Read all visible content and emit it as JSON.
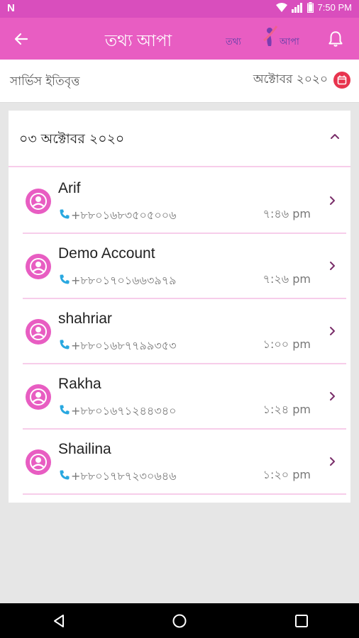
{
  "status_bar": {
    "time": "7:50 PM"
  },
  "app_bar": {
    "title": "তথ্য আপা",
    "logo_text_left": "তথ্য",
    "logo_text_right": "আপা"
  },
  "history_bar": {
    "label": "সার্ভিস ইতিবৃত্ত",
    "month": "অক্টোবর ২০২০"
  },
  "card": {
    "date": "০৩ অক্টোবর ২০২০",
    "items": [
      {
        "name": "Arif",
        "phone": "+৮৮০১৬৮৩৫০৫০০৬",
        "time": "৭:৪৬ pm"
      },
      {
        "name": "Demo Account",
        "phone": "+৮৮০১৭০১৬৬৩৯৭৯",
        "time": "৭:২৬ pm"
      },
      {
        "name": "shahriar",
        "phone": "+৮৮০১৬৮৭৭৯৯৩৫৩",
        "time": "১:০০ pm"
      },
      {
        "name": "Rakha",
        "phone": "+৮৮০১৬৭১২৪৪৩৪০",
        "time": "১:২৪ pm"
      },
      {
        "name": "Shailina",
        "phone": "+৮৮০১৭৮৭২৩০৬৪৬",
        "time": "১:২০ pm"
      }
    ]
  },
  "colors": {
    "primary": "#e85dc2",
    "status_bar": "#d94ebd",
    "accent_red": "#e8344e",
    "divider": "#f7cdea",
    "phone_icon": "#29a8e0"
  }
}
